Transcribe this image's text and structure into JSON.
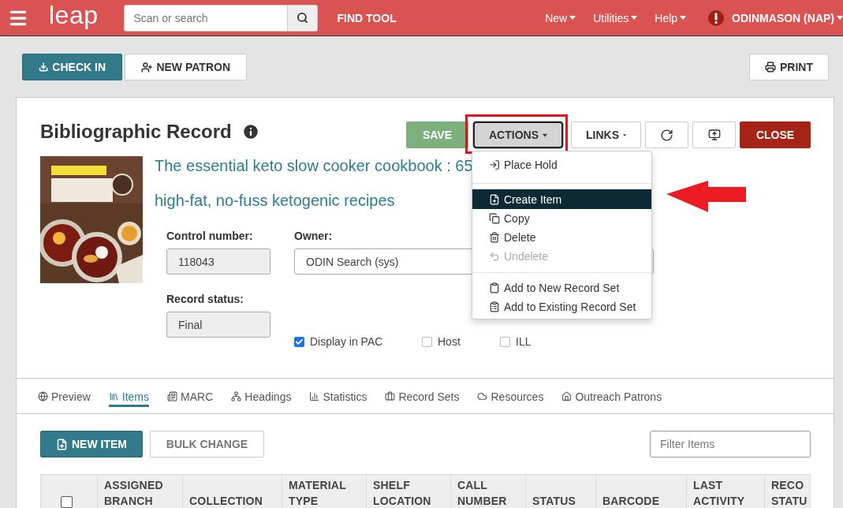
{
  "nav": {
    "logo": "leap",
    "search": {
      "placeholder": "Scan or search"
    },
    "find_tool": "FIND TOOL",
    "menus": [
      {
        "label": "New"
      },
      {
        "label": "Utilities"
      },
      {
        "label": "Help"
      }
    ],
    "user": "ODINMASON (NAP)"
  },
  "toolbar": {
    "buttons": [
      {
        "label": "CHECK IN",
        "kind": "primary"
      },
      {
        "label": "NEW PATRON",
        "kind": "default"
      }
    ],
    "print": "PRINT"
  },
  "record": {
    "heading": "Bibliographic Record",
    "buttons": [
      {
        "label": "SAVE",
        "kind": "save"
      },
      {
        "label": "ACTIONS",
        "kind": "dropdown",
        "expanded": true
      },
      {
        "label": "LINKS",
        "kind": "dropdown",
        "expanded": false
      },
      {
        "kind": "refresh"
      },
      {
        "kind": "export"
      },
      {
        "label": "CLOSE",
        "kind": "close"
      }
    ],
    "cover": {
      "kind": "picture"
    },
    "title_lines": [
      "The essential keto slow cooker cookbook : 65",
      "high-fat, no-fuss ketogenic recipes"
    ],
    "fields": [
      {
        "label": "Control number:",
        "value": "118043",
        "readonly": true
      },
      {
        "label": "Owner:",
        "value": "ODIN Search (sys)",
        "readonly": false
      },
      {
        "label": "Record status:",
        "value": "Final",
        "readonly": true
      }
    ],
    "checkboxes": [
      {
        "label": "Display in PAC",
        "checked": true
      },
      {
        "label": "Host",
        "checked": false
      },
      {
        "label": "ILL",
        "checked": false
      }
    ]
  },
  "actions_menu": {
    "sections": [
      [
        {
          "label": "Place Hold",
          "selected": false,
          "disabled": false
        }
      ],
      [
        {
          "label": "Create Item",
          "selected": true,
          "disabled": false
        },
        {
          "label": "Copy",
          "selected": false,
          "disabled": false
        },
        {
          "label": "Delete",
          "selected": false,
          "disabled": false
        },
        {
          "label": "Undelete",
          "selected": false,
          "disabled": true
        }
      ],
      [
        {
          "label": "Add to New Record Set",
          "selected": false,
          "disabled": false
        },
        {
          "label": "Add to Existing Record Set",
          "selected": false,
          "disabled": false
        }
      ]
    ]
  },
  "tabs": [
    {
      "label": "Preview",
      "selected": false
    },
    {
      "label": "Items",
      "selected": true
    },
    {
      "label": "MARC",
      "selected": false
    },
    {
      "label": "Headings",
      "selected": false
    },
    {
      "label": "Statistics",
      "selected": false
    },
    {
      "label": "Record Sets",
      "selected": false
    },
    {
      "label": "Resources",
      "selected": false
    },
    {
      "label": "Outreach Patrons",
      "selected": false
    }
  ],
  "items_toolbar": {
    "buttons": [
      {
        "label": "NEW ITEM",
        "kind": "primary"
      },
      {
        "label": "BULK CHANGE",
        "kind": "default"
      }
    ],
    "filter": {
      "placeholder": "Filter Items"
    }
  },
  "table": {
    "select_all": {
      "checked": false
    },
    "columns": [
      "ASSIGNED BRANCH",
      "COLLECTION",
      "MATERIAL TYPE",
      "SHELF LOCATION",
      "CALL NUMBER",
      "STATUS",
      "BARCODE",
      "LAST ACTIVITY",
      "RECO STATU"
    ]
  }
}
